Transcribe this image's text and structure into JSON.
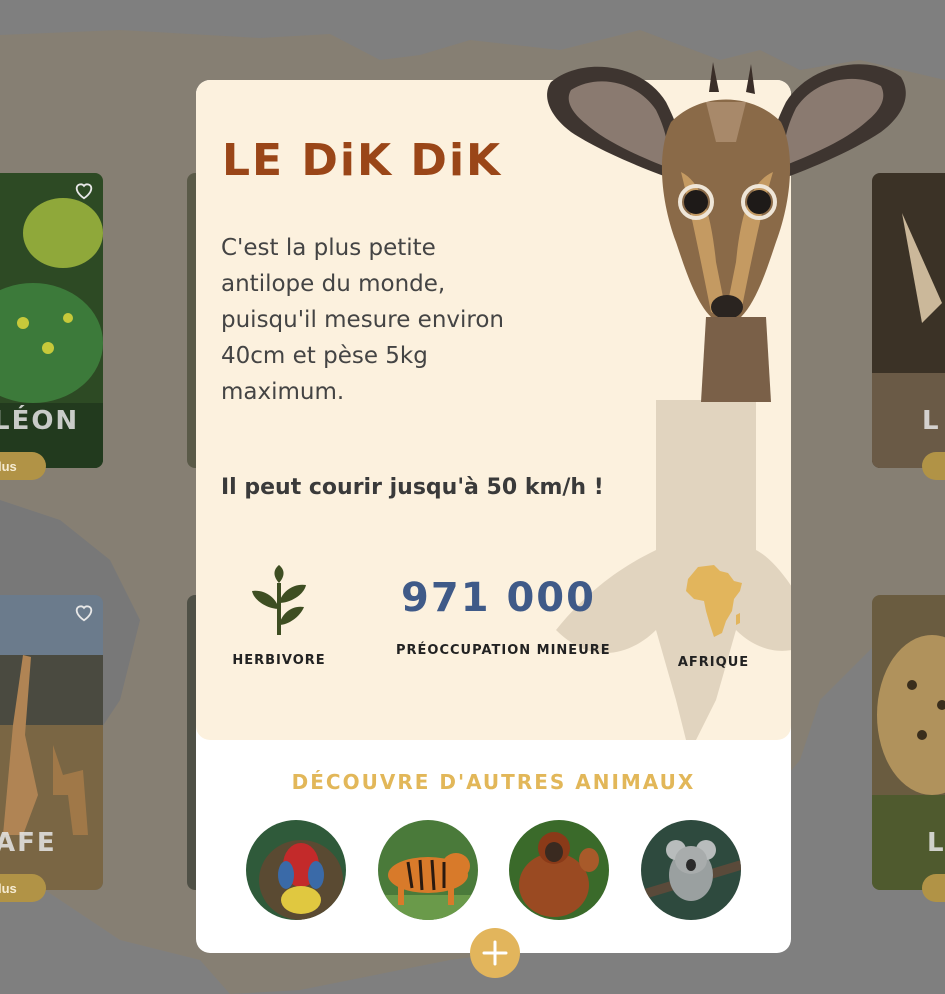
{
  "background": {
    "cards": [
      {
        "name": "LÉON",
        "more": "lus"
      },
      {
        "name": "AFE",
        "more": "lus"
      },
      {
        "name": "L",
        "more": ""
      },
      {
        "name": "L",
        "more": ""
      }
    ]
  },
  "modal": {
    "title": "LE DiK DiK",
    "description": "C'est la plus petite antilope du monde, puisqu'il mesure environ 40cm et pèse 5kg maximum.",
    "fact": "Il peut courir jusqu'à 50 km/h !",
    "stats": {
      "diet": {
        "label": "HERBIVORE",
        "icon": "leaf-icon"
      },
      "population": {
        "value": "971 000",
        "label": "PRÉOCCUPATION MINEURE"
      },
      "region": {
        "label": "AFRIQUE",
        "icon": "africa-icon"
      }
    },
    "others_title": "DÉCOUVRE D'AUTRES ANIMAUX",
    "others": [
      {
        "name": "mandrill"
      },
      {
        "name": "tigre"
      },
      {
        "name": "orang-outan"
      },
      {
        "name": "koala"
      }
    ]
  },
  "colors": {
    "title": "#9a4618",
    "number": "#3f5a88",
    "accent": "#e2b55c",
    "panel": "#fcf1de"
  }
}
